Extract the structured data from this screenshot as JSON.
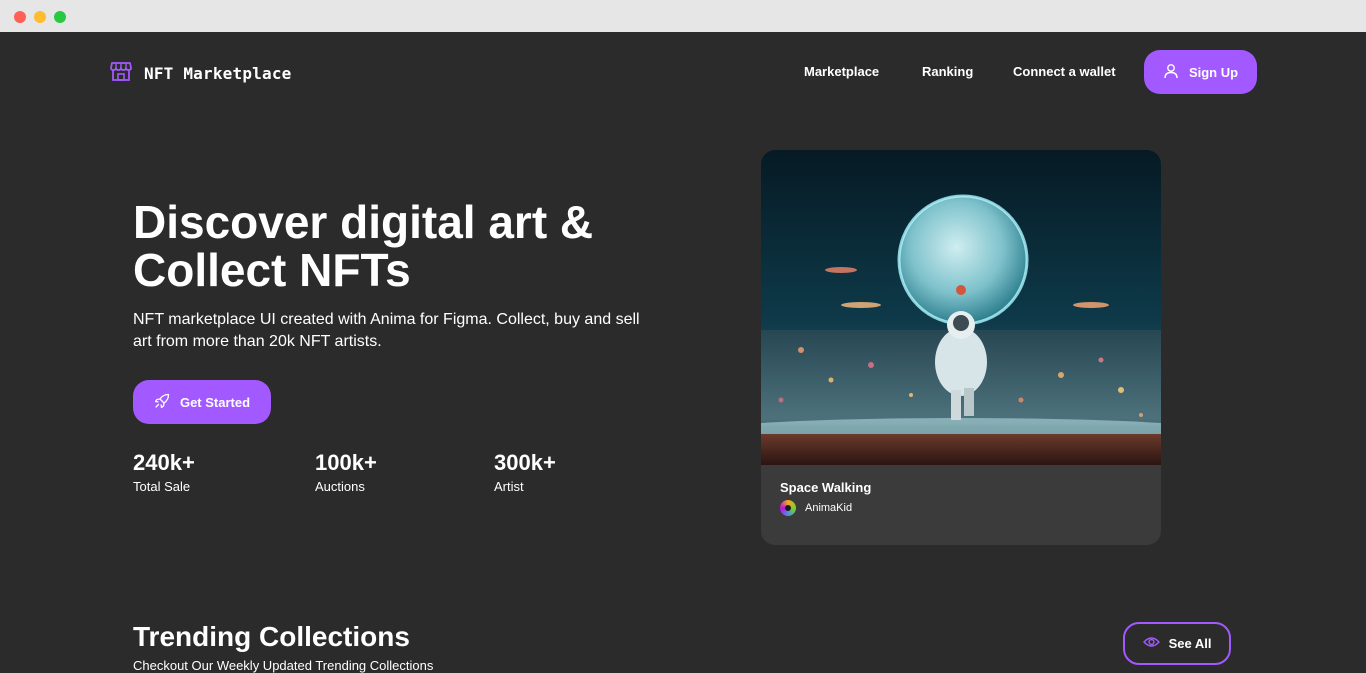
{
  "brand": {
    "name": "NFT Marketplace",
    "icon": "storefront-icon",
    "accent": "#a259ff"
  },
  "nav": {
    "links": [
      "Marketplace",
      "Ranking",
      "Connect a wallet"
    ],
    "signup_label": "Sign Up",
    "signup_icon": "user-icon"
  },
  "hero": {
    "title_line1": "Discover digital art &",
    "title_line2": "Collect NFTs",
    "subtitle_line1": "NFT marketplace UI created with Anima for Figma. Collect, buy and sell",
    "subtitle_line2": "art from more than 20k NFT artists.",
    "cta_label": "Get Started",
    "cta_icon": "rocket-icon"
  },
  "stats": [
    {
      "value": "240k+",
      "label": "Total Sale"
    },
    {
      "value": "100k+",
      "label": "Auctions"
    },
    {
      "value": "300k+",
      "label": "Artist"
    }
  ],
  "featured": {
    "title": "Space Walking",
    "artist": "AnimaKid"
  },
  "trending": {
    "title": "Trending Collections",
    "subtitle": "Checkout Our Weekly Updated Trending Collections",
    "see_all_label": "See All",
    "see_all_icon": "eye-icon"
  }
}
